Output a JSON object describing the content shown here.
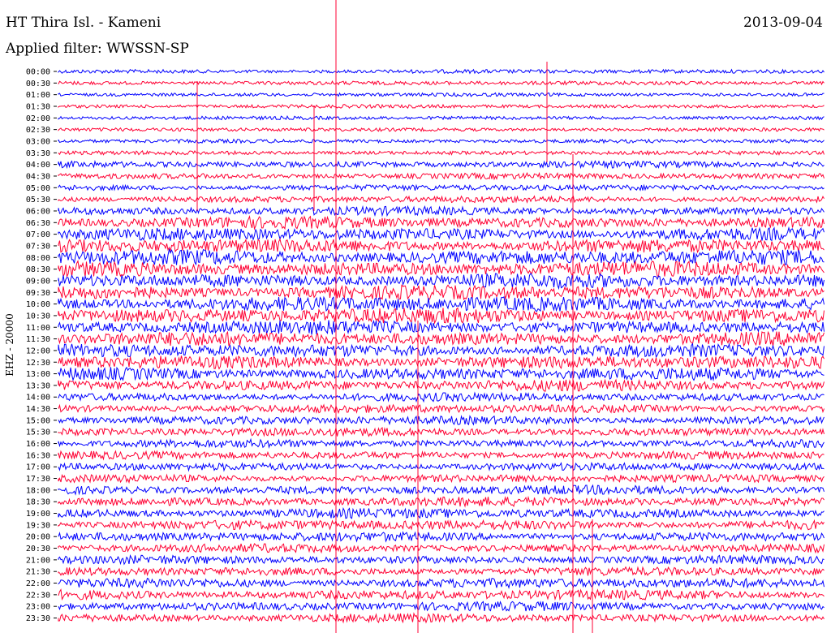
{
  "header": {
    "station": "HT Thira Isl. - Kameni",
    "filter": "Applied filter: WWSSN-SP",
    "date": "2013-09-04",
    "channel": "EHZ - 20000"
  },
  "chart_data": {
    "type": "line",
    "title": "HT Thira Isl. - Kameni",
    "subtitle": "Applied filter: WWSSN-SP",
    "ylabel": "EHZ - 20000",
    "trace_colors": [
      "#0000ff",
      "#ff0033"
    ],
    "marker_color": "#ff0033",
    "grid": false,
    "legend": "none",
    "rows": [
      {
        "label": "00:00",
        "amplitude": 0.15
      },
      {
        "label": "00:30",
        "amplitude": 0.15
      },
      {
        "label": "01:00",
        "amplitude": 0.12
      },
      {
        "label": "01:30",
        "amplitude": 0.12
      },
      {
        "label": "02:00",
        "amplitude": 0.12
      },
      {
        "label": "02:30",
        "amplitude": 0.12
      },
      {
        "label": "03:00",
        "amplitude": 0.14
      },
      {
        "label": "03:30",
        "amplitude": 0.15
      },
      {
        "label": "04:00",
        "amplitude": 0.35
      },
      {
        "label": "04:30",
        "amplitude": 0.3
      },
      {
        "label": "05:00",
        "amplitude": 0.3
      },
      {
        "label": "05:30",
        "amplitude": 0.35
      },
      {
        "label": "06:00",
        "amplitude": 0.5
      },
      {
        "label": "06:30",
        "amplitude": 0.75
      },
      {
        "label": "07:00",
        "amplitude": 0.8
      },
      {
        "label": "07:30",
        "amplitude": 0.9
      },
      {
        "label": "08:00",
        "amplitude": 1.0
      },
      {
        "label": "08:30",
        "amplitude": 1.0
      },
      {
        "label": "09:00",
        "amplitude": 0.95
      },
      {
        "label": "09:30",
        "amplitude": 0.95
      },
      {
        "label": "10:00",
        "amplitude": 1.0
      },
      {
        "label": "10:30",
        "amplitude": 1.0
      },
      {
        "label": "11:00",
        "amplitude": 0.9
      },
      {
        "label": "11:30",
        "amplitude": 0.9
      },
      {
        "label": "12:00",
        "amplitude": 0.85
      },
      {
        "label": "12:30",
        "amplitude": 0.85
      },
      {
        "label": "13:00",
        "amplitude": 0.8
      },
      {
        "label": "13:30",
        "amplitude": 0.7
      },
      {
        "label": "14:00",
        "amplitude": 0.5
      },
      {
        "label": "14:30",
        "amplitude": 0.5
      },
      {
        "label": "15:00",
        "amplitude": 0.5
      },
      {
        "label": "15:30",
        "amplitude": 0.5
      },
      {
        "label": "16:00",
        "amplitude": 0.45
      },
      {
        "label": "16:30",
        "amplitude": 0.45
      },
      {
        "label": "17:00",
        "amplitude": 0.45
      },
      {
        "label": "17:30",
        "amplitude": 0.45
      },
      {
        "label": "18:00",
        "amplitude": 0.55
      },
      {
        "label": "18:30",
        "amplitude": 0.55
      },
      {
        "label": "19:00",
        "amplitude": 0.6
      },
      {
        "label": "19:30",
        "amplitude": 0.6
      },
      {
        "label": "20:00",
        "amplitude": 0.55
      },
      {
        "label": "20:30",
        "amplitude": 0.5
      },
      {
        "label": "21:00",
        "amplitude": 0.5
      },
      {
        "label": "21:30",
        "amplitude": 0.5
      },
      {
        "label": "22:00",
        "amplitude": 0.6
      },
      {
        "label": "22:30",
        "amplitude": 0.6
      },
      {
        "label": "23:00",
        "amplitude": 0.55
      },
      {
        "label": "23:30",
        "amplitude": 0.5
      }
    ]
  }
}
